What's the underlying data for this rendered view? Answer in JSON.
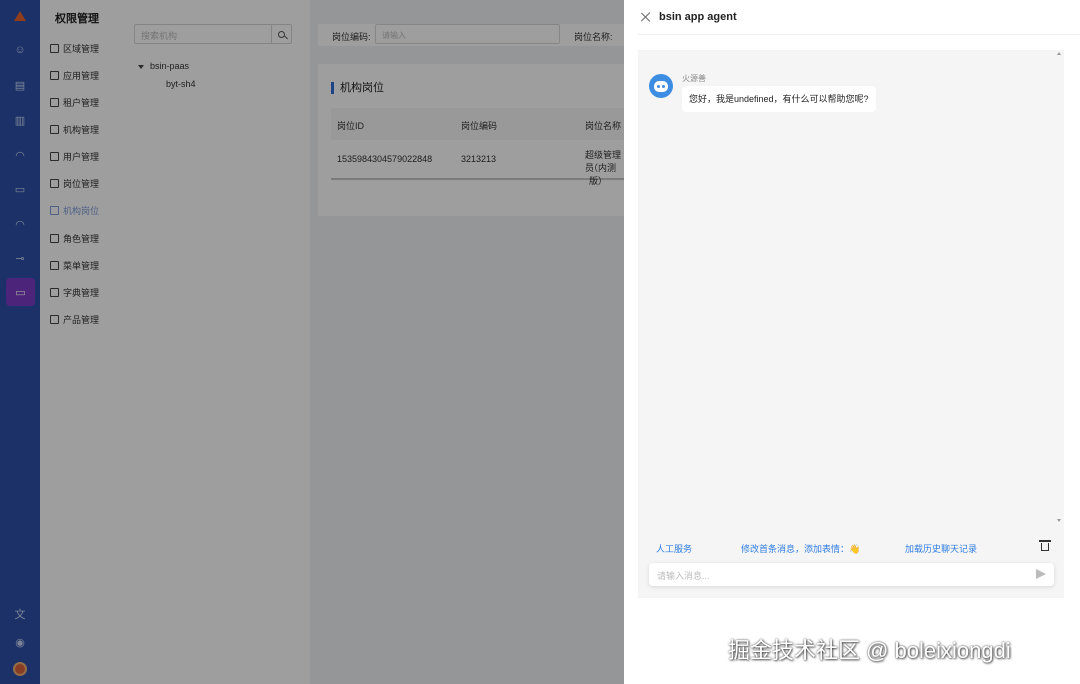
{
  "menu": {
    "title": "权限管理",
    "items": [
      {
        "label": "区域管理",
        "icon": "region-icon"
      },
      {
        "label": "应用管理",
        "icon": "app-icon"
      },
      {
        "label": "租户管理",
        "icon": "tenant-icon"
      },
      {
        "label": "机构管理",
        "icon": "org-icon"
      },
      {
        "label": "用户管理",
        "icon": "user-icon"
      },
      {
        "label": "岗位管理",
        "icon": "post-icon"
      },
      {
        "label": "机构岗位",
        "icon": "org-post-icon",
        "active": true
      },
      {
        "label": "角色管理",
        "icon": "role-icon"
      },
      {
        "label": "菜单管理",
        "icon": "menu-icon"
      },
      {
        "label": "字典管理",
        "icon": "dict-icon"
      },
      {
        "label": "产品管理",
        "icon": "product-icon"
      }
    ]
  },
  "tree": {
    "search_placeholder": "搜索机构",
    "root": "bsin-paas",
    "child": "byt-sh4"
  },
  "form": {
    "code_label": "岗位编码:",
    "code_placeholder": "请输入",
    "name_label": "岗位名称:"
  },
  "table": {
    "title": "机构岗位",
    "columns": [
      "岗位ID",
      "岗位编码",
      "岗位名称"
    ],
    "rows": [
      {
        "id": "1535984304579022848",
        "code": "3213213",
        "name_line1": "超级管理员",
        "name_line2": "（内测版）"
      }
    ]
  },
  "drawer": {
    "title": "bsin app agent",
    "bot_name": "火源善",
    "greeting": "您好，我是undefined，有什么可以帮助您呢?",
    "quick_links": [
      "人工服务",
      "修改首条消息，添加表情：👋",
      "加载历史聊天记录"
    ],
    "input_placeholder": "请输入消息..."
  },
  "watermark": "掘金技术社区 @ boleixiongdi",
  "colors": {
    "rail": "#2c50a8",
    "rail_active": "#7b3bc6",
    "accent": "#2f6fd6",
    "link": "#2f7de1"
  }
}
